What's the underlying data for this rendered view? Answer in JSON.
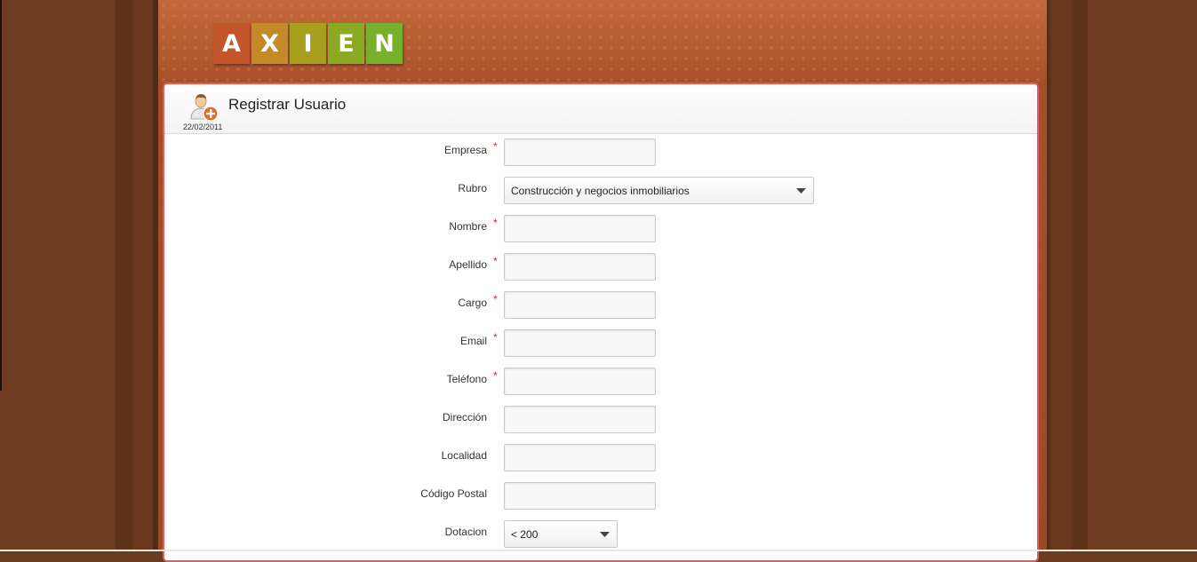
{
  "logo": {
    "letters": [
      "A",
      "X",
      "I",
      "E",
      "N"
    ],
    "colors": [
      "#c2562a",
      "#c48a2a",
      "#a7a01c",
      "#8aaa24",
      "#78b02c"
    ]
  },
  "header": {
    "title": "Registrar Usuario",
    "date": "22/02/2011",
    "icon": "add-user-icon"
  },
  "form": {
    "fields": [
      {
        "key": "empresa",
        "label": "Empresa",
        "required": "*",
        "type": "text",
        "value": ""
      },
      {
        "key": "rubro",
        "label": "Rubro",
        "required": "",
        "type": "select",
        "value": "Construcción y negocios inmobiliarios"
      },
      {
        "key": "nombre",
        "label": "Nombre",
        "required": "*",
        "type": "text",
        "value": ""
      },
      {
        "key": "apellido",
        "label": "Apellido",
        "required": "*",
        "type": "text",
        "value": ""
      },
      {
        "key": "cargo",
        "label": "Cargo",
        "required": "*",
        "type": "text",
        "value": ""
      },
      {
        "key": "email",
        "label": "Email",
        "required": "*",
        "type": "text",
        "value": ""
      },
      {
        "key": "telefono",
        "label": "Teléfono",
        "required": "*",
        "type": "text",
        "value": ""
      },
      {
        "key": "direccion",
        "label": "Dirección",
        "required": "",
        "type": "text",
        "value": ""
      },
      {
        "key": "localidad",
        "label": "Localidad",
        "required": "",
        "type": "text",
        "value": ""
      },
      {
        "key": "codigo_postal",
        "label": "Código Postal",
        "required": "",
        "type": "text",
        "value": ""
      },
      {
        "key": "dotacion",
        "label": "Dotacion",
        "required": "",
        "type": "select",
        "value": "< 200"
      }
    ]
  }
}
